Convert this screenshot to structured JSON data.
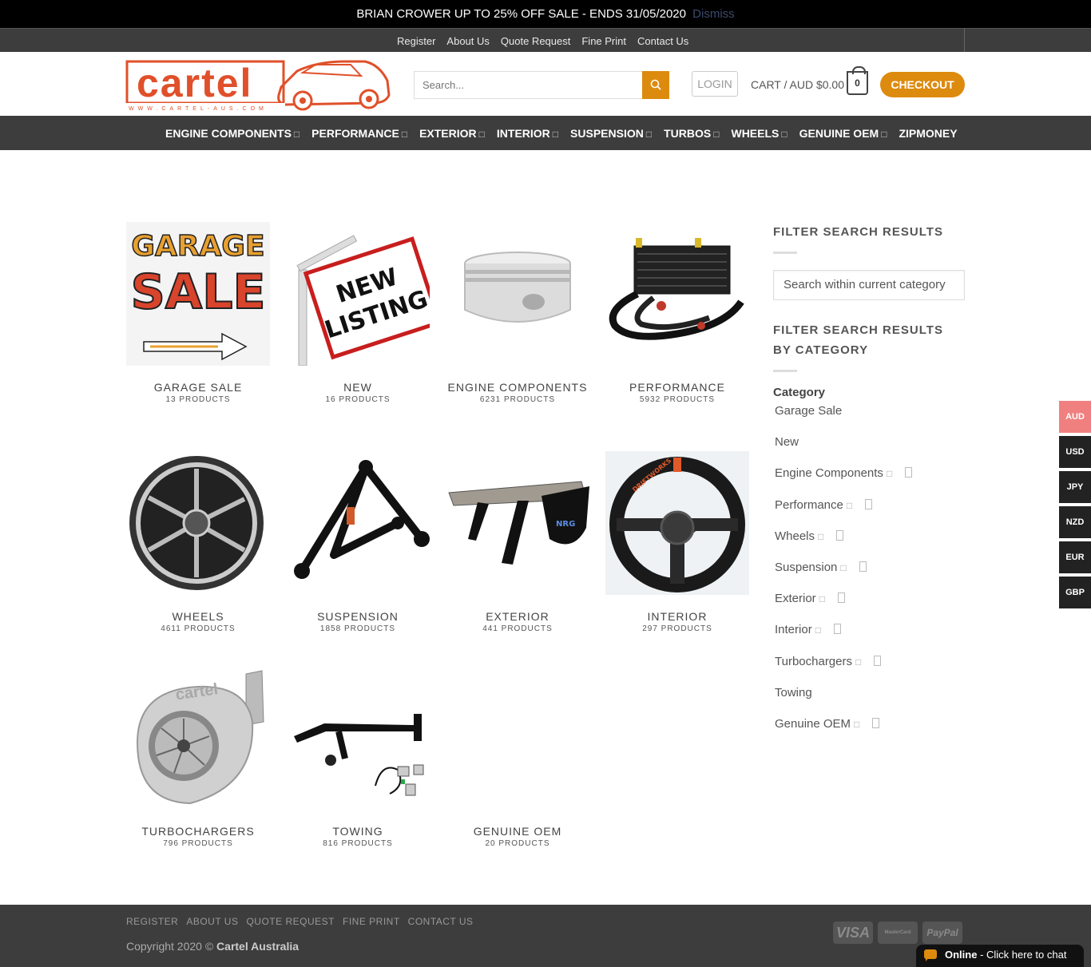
{
  "promo": {
    "text": "BRIAN CROWER UP TO 25% OFF SALE - ENDS 31/05/2020",
    "dismiss": "Dismiss"
  },
  "topnav": {
    "links": [
      "Register",
      "About Us",
      "Quote Request",
      "Fine Print",
      "Contact Us"
    ]
  },
  "header": {
    "logo_text": "cartel",
    "logo_sub": "WWW.CARTEL-AUS.COM",
    "search_placeholder": "Search...",
    "search_icon": "search-icon",
    "login_label": "LOGIN",
    "cart_label": "CART / AUD $0.00",
    "cart_count": "0",
    "checkout_label": "CHECKOUT"
  },
  "mainnav": {
    "items": [
      {
        "label": "ENGINE COMPONENTS",
        "arrow": "□"
      },
      {
        "label": "PERFORMANCE",
        "arrow": "□"
      },
      {
        "label": "EXTERIOR",
        "arrow": "□"
      },
      {
        "label": "INTERIOR",
        "arrow": "□"
      },
      {
        "label": "SUSPENSION",
        "arrow": "□"
      },
      {
        "label": "TURBOS",
        "arrow": "□"
      },
      {
        "label": "WHEELS",
        "arrow": "□"
      },
      {
        "label": "GENUINE OEM",
        "arrow": "□"
      },
      {
        "label": "ZIPMONEY",
        "arrow": ""
      }
    ]
  },
  "categories": [
    {
      "name": "GARAGE SALE",
      "count": "13 PRODUCTS"
    },
    {
      "name": "NEW",
      "count": "16 PRODUCTS"
    },
    {
      "name": "ENGINE COMPONENTS",
      "count": "6231 PRODUCTS"
    },
    {
      "name": "PERFORMANCE",
      "count": "5932 PRODUCTS"
    },
    {
      "name": "WHEELS",
      "count": "4611 PRODUCTS"
    },
    {
      "name": "SUSPENSION",
      "count": "1858 PRODUCTS"
    },
    {
      "name": "EXTERIOR",
      "count": "441 PRODUCTS"
    },
    {
      "name": "INTERIOR",
      "count": "297 PRODUCTS"
    },
    {
      "name": "TURBOCHARGERS",
      "count": "796 PRODUCTS"
    },
    {
      "name": "TOWING",
      "count": "816 PRODUCTS"
    },
    {
      "name": "GENUINE OEM",
      "count": "20 PRODUCTS"
    }
  ],
  "thumb_text": {
    "garage_line1": "GARAGE",
    "garage_line2": "SALE",
    "new_line1": "NEW",
    "new_line2": "LISTING",
    "steering_brand": "DRIFTWORKS",
    "wing_brand": "NRG",
    "turbo_brand": "cartel"
  },
  "sidebar": {
    "filter_title": "FILTER SEARCH RESULTS",
    "filter_placeholder": "Search within current category",
    "category_title": "FILTER SEARCH RESULTS BY CATEGORY",
    "category_label": "Category",
    "items": [
      {
        "label": "Garage Sale",
        "exp": "",
        "box": false
      },
      {
        "label": "New",
        "exp": "",
        "box": false
      },
      {
        "label": "Engine Components",
        "exp": "□",
        "box": true
      },
      {
        "label": "Performance",
        "exp": "□",
        "box": true
      },
      {
        "label": "Wheels",
        "exp": "□",
        "box": true
      },
      {
        "label": "Suspension",
        "exp": "□",
        "box": true
      },
      {
        "label": "Exterior",
        "exp": "□",
        "box": true
      },
      {
        "label": "Interior",
        "exp": "□",
        "box": true
      },
      {
        "label": "Turbochargers",
        "exp": "□",
        "box": true
      },
      {
        "label": "Towing",
        "exp": "",
        "box": false
      },
      {
        "label": "Genuine OEM",
        "exp": "□",
        "box": true
      }
    ]
  },
  "currencies": [
    {
      "code": "AUD",
      "active": true
    },
    {
      "code": "USD",
      "active": false
    },
    {
      "code": "JPY",
      "active": false
    },
    {
      "code": "NZD",
      "active": false
    },
    {
      "code": "EUR",
      "active": false
    },
    {
      "code": "GBP",
      "active": false
    }
  ],
  "footer": {
    "links": [
      "REGISTER",
      "ABOUT US",
      "QUOTE REQUEST",
      "FINE PRINT",
      "CONTACT US"
    ],
    "copyright_prefix": "Copyright 2020 ©",
    "copyright_brand": "Cartel Australia",
    "payments": [
      "VISA",
      "MasterCard",
      "PayPal"
    ]
  },
  "chat": {
    "status": "Online",
    "text": "- Click here to chat"
  },
  "colors": {
    "accent": "#dd8b0e",
    "nav_bg": "#3d3d3d",
    "logo": "#e0502a",
    "active_currency": "#f07f7f"
  }
}
